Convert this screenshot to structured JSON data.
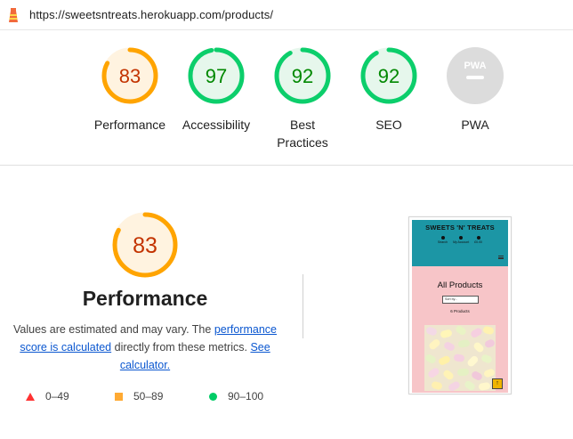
{
  "url_bar": {
    "url": "https://sweetsntreats.herokuapp.com/products/",
    "logo_icon": "lighthouse-icon"
  },
  "colors": {
    "average": "#ffa400",
    "average_text": "#c33300",
    "average_bg": "#fff3e0",
    "pass": "#0cce6b",
    "pass_text": "#008800",
    "pass_bg": "#e6f7ec",
    "pwa_gray": "#c8c8c8",
    "fail": "#ff3333",
    "link": "#0b57d0"
  },
  "gauges": [
    {
      "id": "performance",
      "score": "83",
      "label": "Performance",
      "status": "average"
    },
    {
      "id": "accessibility",
      "score": "97",
      "label": "Accessibility",
      "status": "pass"
    },
    {
      "id": "best-practices",
      "score": "92",
      "label": "Best Practices",
      "status": "pass"
    },
    {
      "id": "seo",
      "score": "92",
      "label": "SEO",
      "status": "pass"
    },
    {
      "id": "pwa",
      "score": "",
      "label": "PWA",
      "status": "na",
      "badge_text": "PWA"
    }
  ],
  "performance_detail": {
    "score": "83",
    "title": "Performance",
    "desc_prefix": "Values are estimated and may vary. The ",
    "desc_link1": "performance score is calculated",
    "desc_middle": " directly from these metrics. ",
    "desc_link2": "See calculator.",
    "desc_suffix": ""
  },
  "legend": [
    {
      "range": "0–49",
      "icon": "red-triangle-icon"
    },
    {
      "range": "50–89",
      "icon": "orange-square-icon"
    },
    {
      "range": "90–100",
      "icon": "green-circle-icon"
    }
  ],
  "screenshot_preview": {
    "brand": "SWEETS 'N' TREATS",
    "nav": [
      {
        "label": "Search",
        "icon": "search-icon"
      },
      {
        "label": "My Account",
        "icon": "user-icon"
      },
      {
        "label": "£0.00",
        "icon": "basket-icon"
      }
    ],
    "menu_icon": "hamburger-icon",
    "page_title": "All Products",
    "sort_placeholder": "Sort by...",
    "product_count": "6 Products",
    "back_to_top_icon": "arrow-up-icon"
  }
}
